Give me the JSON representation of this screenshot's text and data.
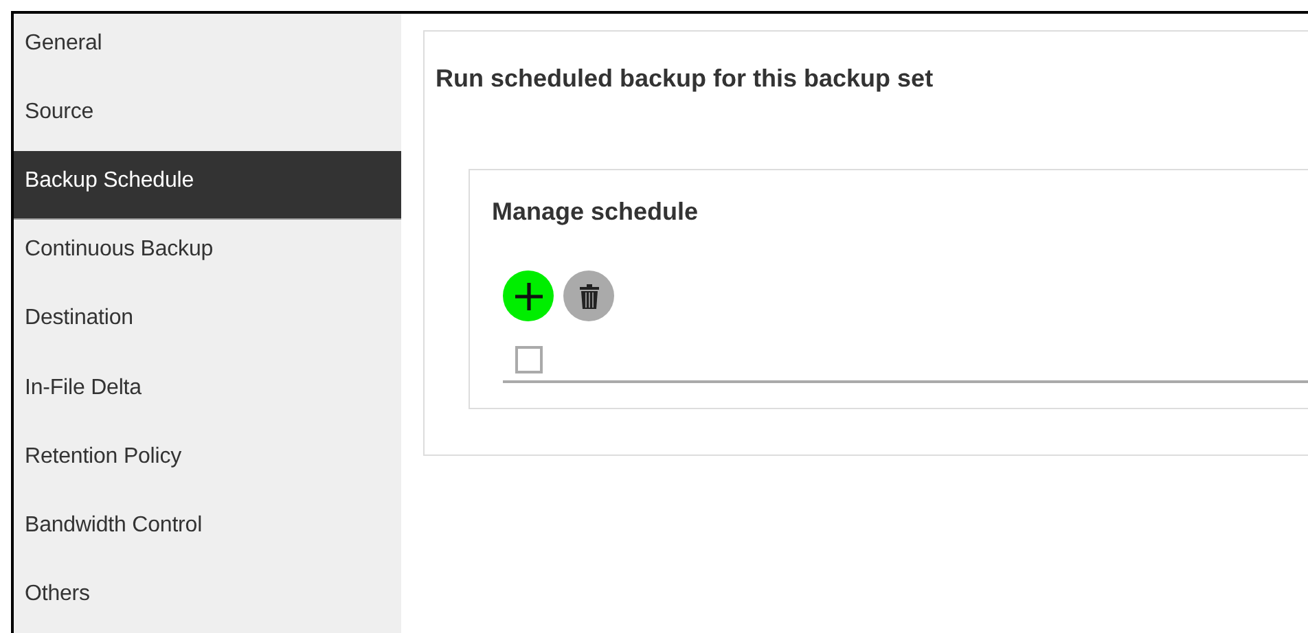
{
  "sidebar": {
    "items": [
      {
        "label": "General",
        "selected": false
      },
      {
        "label": "Source",
        "selected": false
      },
      {
        "label": "Backup Schedule",
        "selected": true
      },
      {
        "label": "Continuous Backup",
        "selected": false
      },
      {
        "label": "Destination",
        "selected": false
      },
      {
        "label": "In-File Delta",
        "selected": false
      },
      {
        "label": "Retention Policy",
        "selected": false
      },
      {
        "label": "Bandwidth Control",
        "selected": false
      },
      {
        "label": "Others",
        "selected": false
      }
    ]
  },
  "content": {
    "title": "Run scheduled backup for this backup set",
    "schedule_card": {
      "title": "Manage schedule",
      "toolbar": [
        {
          "kind": "add"
        },
        {
          "kind": "delete"
        }
      ],
      "table": {
        "select_all": {
          "checked": false
        }
      }
    }
  }
}
